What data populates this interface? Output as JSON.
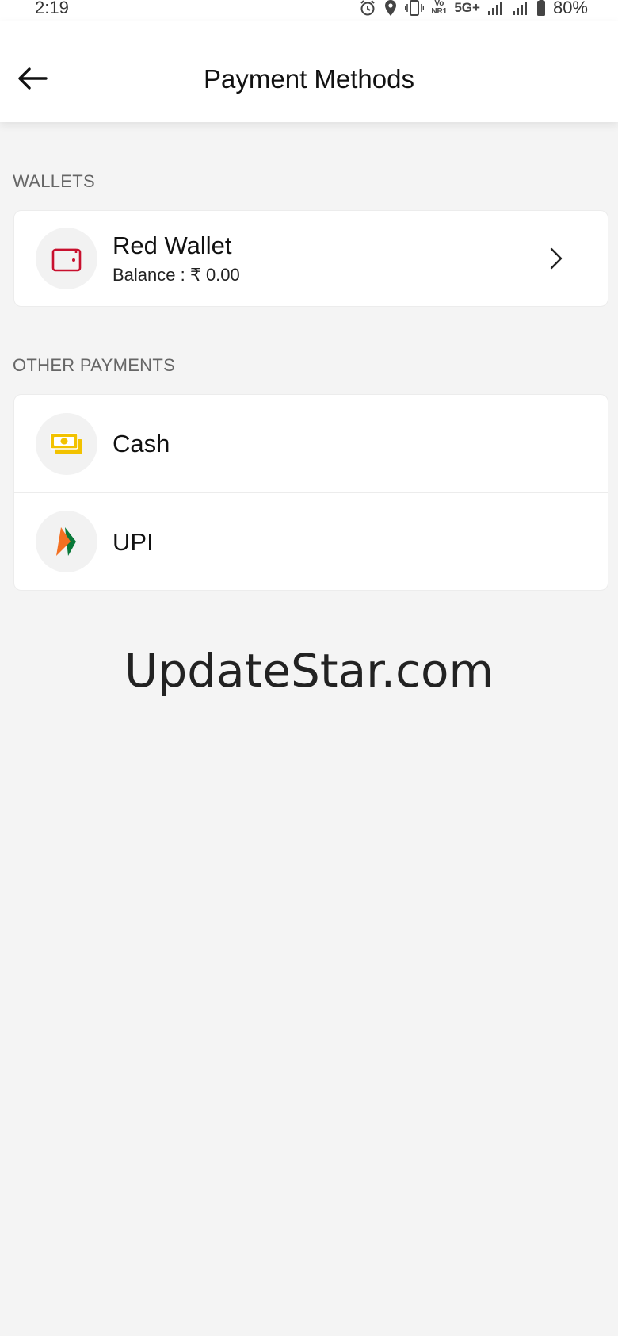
{
  "status_bar": {
    "time": "2:19",
    "network_top": "Vo",
    "network_bottom": "NR1",
    "network_type": "5G+",
    "battery": "80%",
    "icons": [
      "alarm-icon",
      "location-icon",
      "vibrate-icon",
      "volte-icon",
      "signal-icon",
      "signal-icon",
      "battery-icon"
    ]
  },
  "header": {
    "title": "Payment Methods",
    "back_icon": "back-arrow-icon"
  },
  "wallets": {
    "label": "WALLETS",
    "items": [
      {
        "name": "Red Wallet",
        "subtitle": "Balance : ₹ 0.00",
        "icon": "wallet-icon",
        "icon_color": "#c8102e"
      }
    ]
  },
  "other_payments": {
    "label": "OTHER PAYMENTS",
    "items": [
      {
        "name": "Cash",
        "icon": "cash-icon",
        "icon_color": "#f2c200"
      },
      {
        "name": "UPI",
        "icon": "upi-logo-icon",
        "icon_colors": [
          "#f37021",
          "#097939"
        ]
      }
    ]
  },
  "watermark": "UpdateStar.com",
  "colors": {
    "background": "#f4f4f4",
    "card": "#ffffff",
    "section_label": "#666666",
    "accent_red": "#c8102e"
  }
}
